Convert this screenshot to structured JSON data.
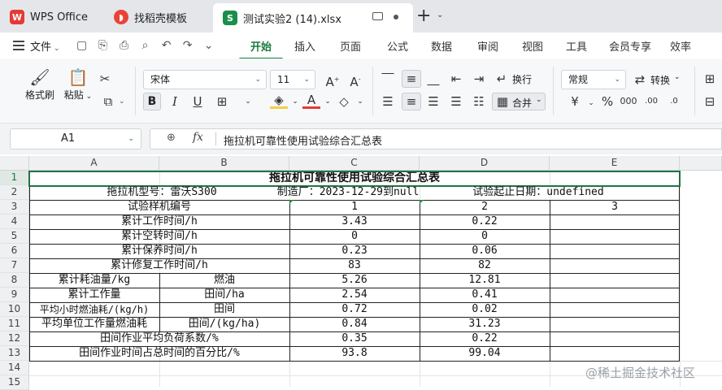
{
  "tabs": {
    "wps": "WPS Office",
    "daoke": "找稻壳模板",
    "doc": "测试实验2 (14).xlsx"
  },
  "menu": {
    "file": "文件",
    "items": [
      "开始",
      "插入",
      "页面",
      "公式",
      "数据",
      "审阅",
      "视图",
      "工具",
      "会员专享",
      "效率"
    ]
  },
  "ribbon": {
    "format_painter": "格式刷",
    "paste": "粘贴",
    "font_name": "宋体",
    "font_size": "11",
    "wrap": "换行",
    "merge": "合并",
    "number_format": "常规",
    "convert": "转换"
  },
  "formula_bar": {
    "cell_ref": "A1",
    "formula": "拖拉机可靠性使用试验综合汇总表"
  },
  "grid": {
    "columns": [
      "A",
      "B",
      "C",
      "D",
      "E"
    ],
    "rows": [
      "1",
      "2",
      "3",
      "4",
      "5",
      "6",
      "7",
      "8",
      "9",
      "10",
      "11",
      "12",
      "13",
      "14",
      "15"
    ]
  },
  "sheet": {
    "title": "拖拉机可靠性使用试验综合汇总表",
    "row2": {
      "a": "拖拉机型号：雷沃S300",
      "c": "制造厂：2023-12-29到null",
      "e": "试验起止日期：undefined"
    },
    "row3": {
      "label": "试验样机编号",
      "c": "1",
      "d": "2",
      "e": "3"
    },
    "row4": {
      "label": "累计工作时间/h",
      "c": "3.43",
      "d": "0.22"
    },
    "row5": {
      "label": "累计空转时间/h",
      "c": "0",
      "d": "0"
    },
    "row6": {
      "label": "累计保养时间/h",
      "c": "0.23",
      "d": "0.06"
    },
    "row7": {
      "label": "累计修复工作时间/h",
      "c": "83",
      "d": "82"
    },
    "row8": {
      "a": "累计耗油量/kg",
      "b": "燃油",
      "c": "5.26",
      "d": "12.81"
    },
    "row9": {
      "a": "累计工作量",
      "b": "田间/ha",
      "c": "2.54",
      "d": "0.41"
    },
    "row10": {
      "a": "平均小时燃油耗/(kg/h)",
      "b": "田间",
      "c": "0.72",
      "d": "0.02"
    },
    "row11": {
      "a": "平均单位工作量燃油耗",
      "b": "田间/(kg/ha)",
      "c": "0.84",
      "d": "31.23"
    },
    "row12": {
      "label": "田间作业平均负荷系数/%",
      "c": "0.35",
      "d": "0.22"
    },
    "row13": {
      "label": "田间作业时间占总时间的百分比/%",
      "c": "93.8",
      "d": "99.04"
    }
  },
  "watermark": "@稀土掘金技术社区"
}
